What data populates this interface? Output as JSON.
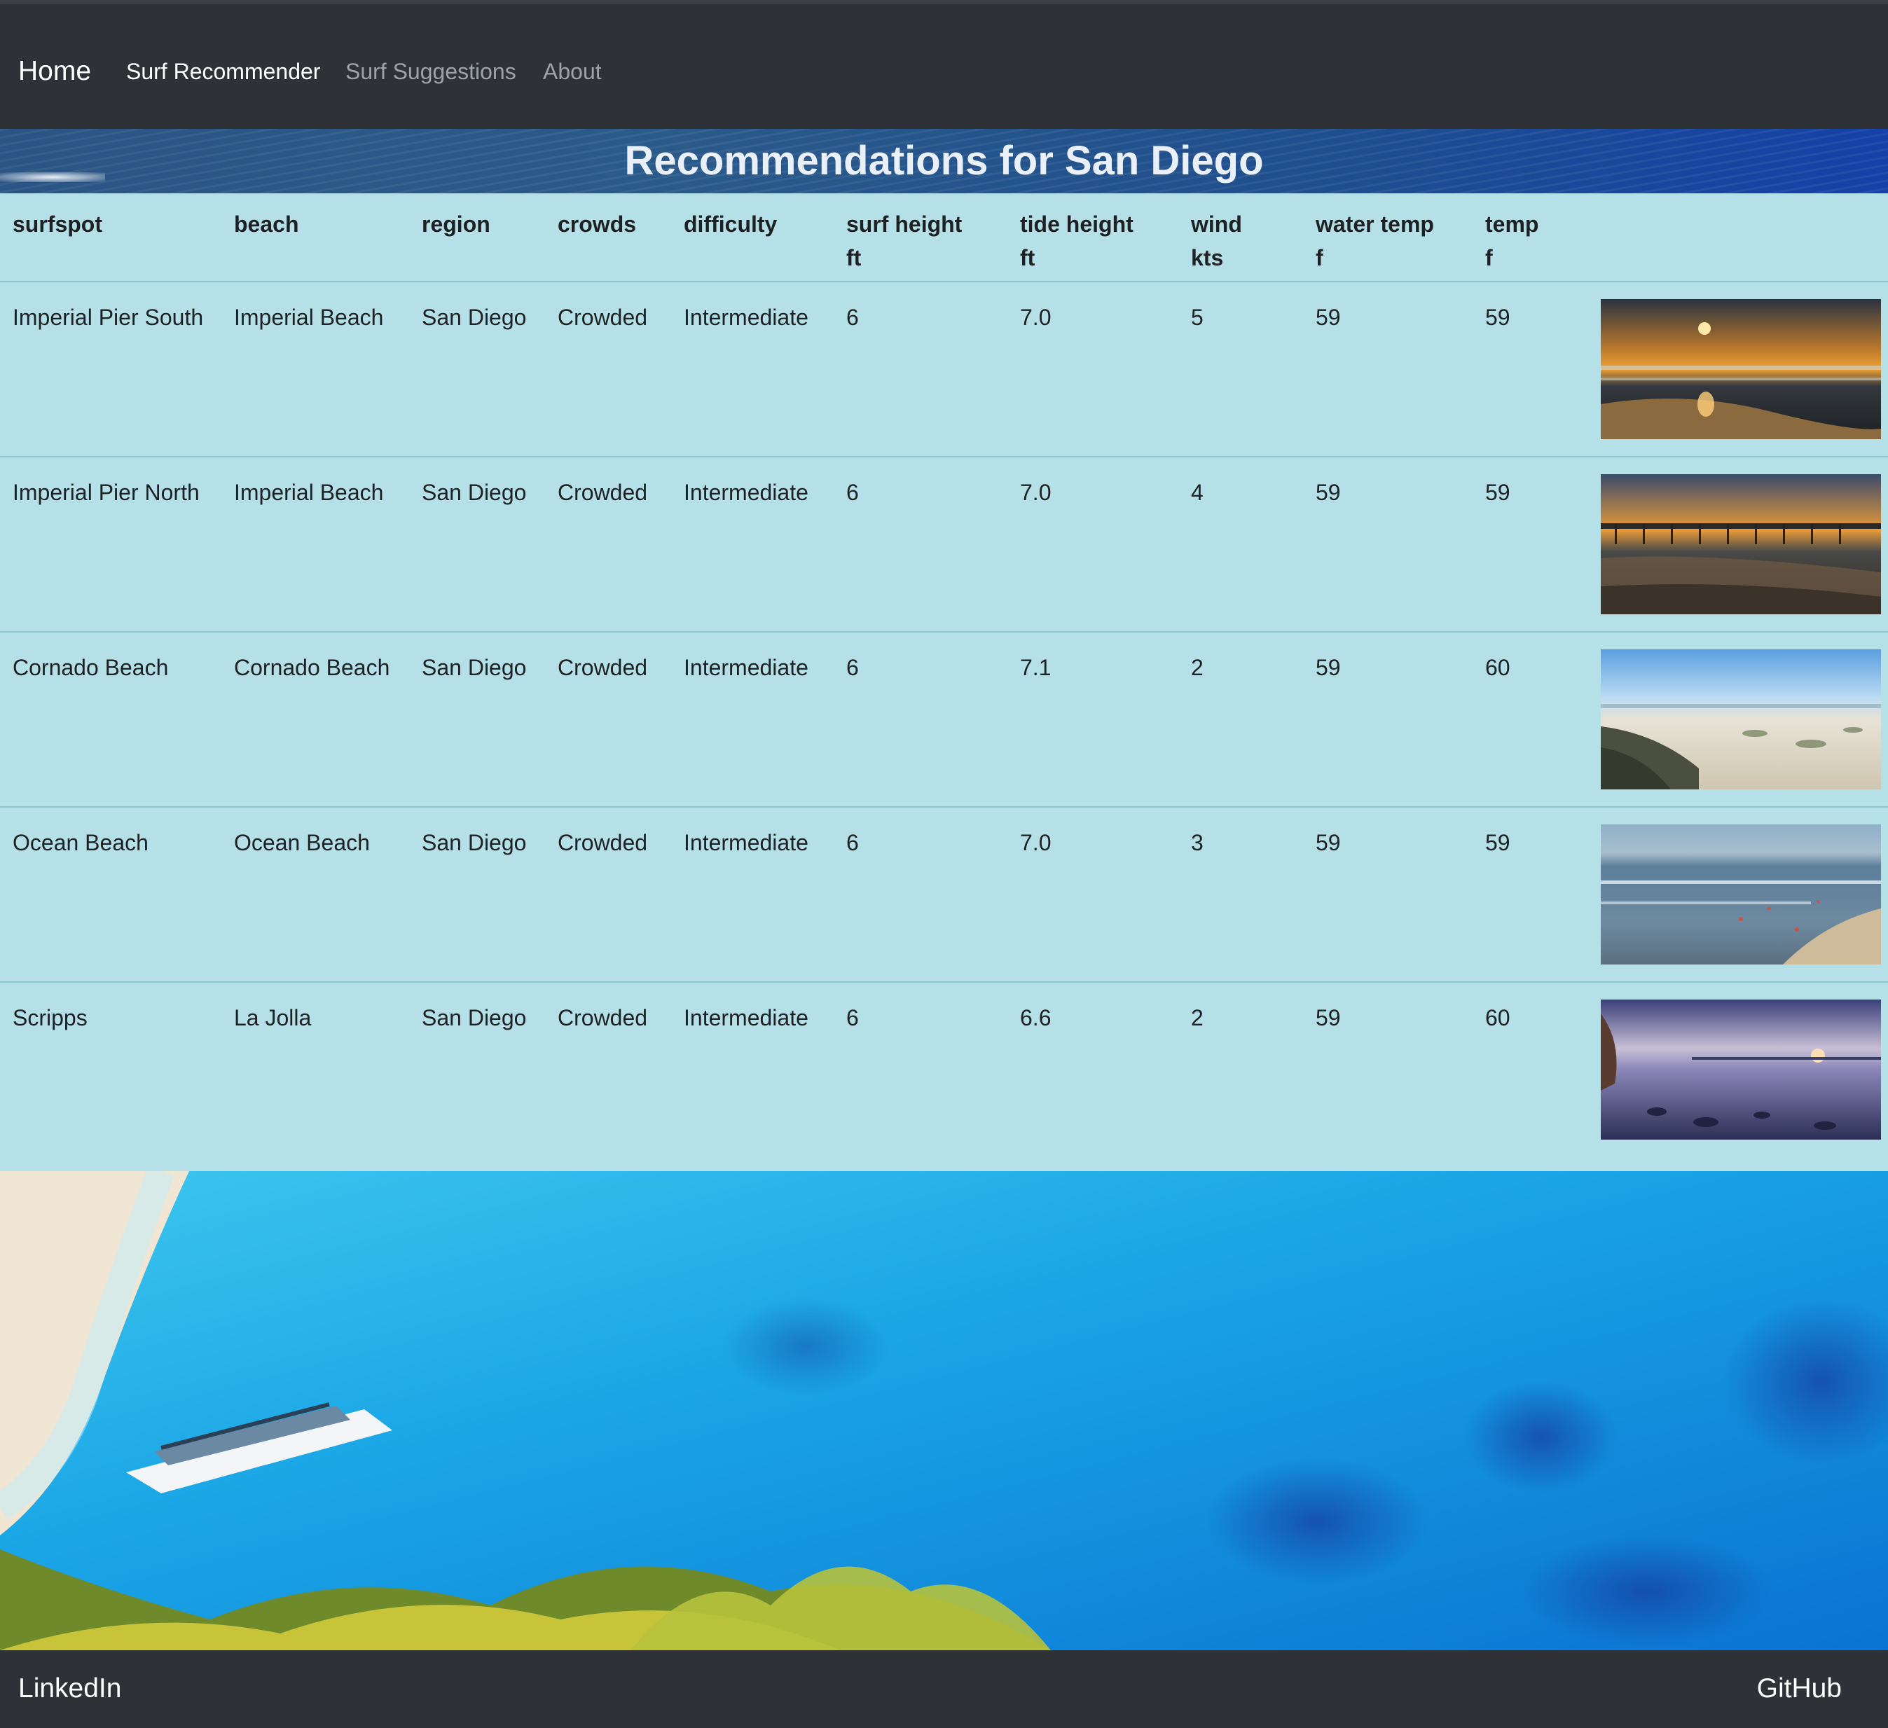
{
  "nav": {
    "brand": "Home",
    "links": [
      {
        "label": "Surf Recommender",
        "active": true
      },
      {
        "label": "Surf Suggestions",
        "active": false
      },
      {
        "label": "About",
        "active": false
      }
    ]
  },
  "hero": {
    "title": "Recommendations for San Diego"
  },
  "table": {
    "headers": {
      "surfspot": "surfspot",
      "beach": "beach",
      "region": "region",
      "crowds": "crowds",
      "difficulty": "difficulty",
      "surf_height": "surf height",
      "surf_height_unit": "ft",
      "tide_height": "tide height",
      "tide_height_unit": "ft",
      "wind": "wind",
      "wind_unit": "kts",
      "water_temp": "water temp",
      "water_temp_unit": "f",
      "temp": "temp",
      "temp_unit": "f"
    },
    "rows": [
      {
        "surfspot": "Imperial Pier South",
        "beach": "Imperial Beach",
        "region": "San Diego",
        "crowds": "Crowded",
        "difficulty": "Intermediate",
        "surf_height": "6",
        "tide_height": "7.0",
        "wind": "5",
        "water_temp": "59",
        "temp": "59",
        "photo": "sunset-surf-photo"
      },
      {
        "surfspot": "Imperial Pier North",
        "beach": "Imperial Beach",
        "region": "San Diego",
        "crowds": "Crowded",
        "difficulty": "Intermediate",
        "surf_height": "6",
        "tide_height": "7.0",
        "wind": "4",
        "water_temp": "59",
        "temp": "59",
        "photo": "pier-sunset-photo"
      },
      {
        "surfspot": "Cornado Beach",
        "beach": "Cornado Beach",
        "region": "San Diego",
        "crowds": "Crowded",
        "difficulty": "Intermediate",
        "surf_height": "6",
        "tide_height": "7.1",
        "wind": "2",
        "water_temp": "59",
        "temp": "60",
        "photo": "sandy-beach-photo"
      },
      {
        "surfspot": "Ocean Beach",
        "beach": "Ocean Beach",
        "region": "San Diego",
        "crowds": "Crowded",
        "difficulty": "Intermediate",
        "surf_height": "6",
        "tide_height": "7.0",
        "wind": "3",
        "water_temp": "59",
        "temp": "59",
        "photo": "shoreline-photo"
      },
      {
        "surfspot": "Scripps",
        "beach": "La Jolla",
        "region": "San Diego",
        "crowds": "Crowded",
        "difficulty": "Intermediate",
        "surf_height": "6",
        "tide_height": "6.6",
        "wind": "2",
        "water_temp": "59",
        "temp": "60",
        "photo": "rocky-pier-sunset-photo"
      }
    ]
  },
  "footer": {
    "left_link": "LinkedIn",
    "right_link": "GitHub"
  },
  "colors": {
    "navbar": "#2e3237",
    "table_bg": "#b6e0e8",
    "row_border": "#8cc7d1",
    "hero_title": "#e9f0f8"
  }
}
